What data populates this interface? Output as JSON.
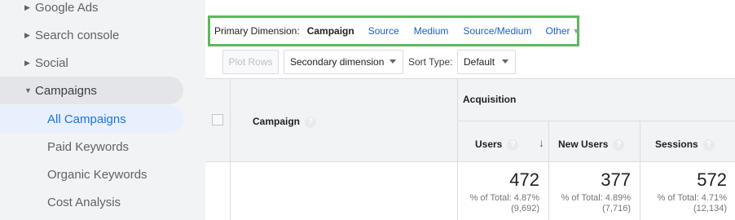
{
  "sidebar": {
    "items": [
      {
        "label": "Google Ads",
        "caret": "▶"
      },
      {
        "label": "Search console",
        "caret": "▶"
      },
      {
        "label": "Social",
        "caret": "▶"
      },
      {
        "label": "Campaigns",
        "caret": "▼"
      },
      {
        "label": "All Campaigns"
      },
      {
        "label": "Paid Keywords"
      },
      {
        "label": "Organic Keywords"
      },
      {
        "label": "Cost Analysis"
      }
    ]
  },
  "primary_dimension": {
    "label": "Primary Dimension:",
    "current": "Campaign",
    "options": [
      "Source",
      "Medium",
      "Source/Medium",
      "Other"
    ]
  },
  "toolbar": {
    "plot_rows": "Plot Rows",
    "secondary_dimension": "Secondary dimension",
    "sort_type_label": "Sort Type:",
    "sort_type_value": "Default"
  },
  "table": {
    "campaign_header": "Campaign",
    "group_header": "Acquisition",
    "columns": [
      {
        "name": "Users",
        "total": "472",
        "pct_line": "% of Total: 4.87%",
        "total_line": "(9,692)"
      },
      {
        "name": "New Users",
        "total": "377",
        "pct_line": "% of Total: 4.89%",
        "total_line": "(7,716)"
      },
      {
        "name": "Sessions",
        "total": "572",
        "pct_line": "% of Total: 4.71%",
        "total_line": "(12,134)"
      }
    ]
  },
  "icons": {
    "help": "?",
    "sort_desc": "↓"
  },
  "colors": {
    "highlight_border": "#5cb85c",
    "link": "#1a5fc8",
    "active_nav": "#1a73e8"
  }
}
